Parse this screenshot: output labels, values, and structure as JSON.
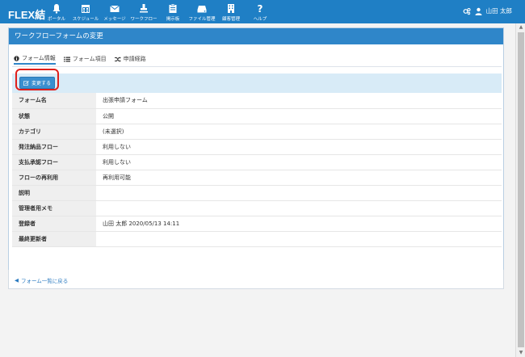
{
  "app": {
    "logo": "FLEX結"
  },
  "nav": [
    {
      "id": "portal",
      "label": "ポータル"
    },
    {
      "id": "schedule",
      "label": "スケジュール"
    },
    {
      "id": "message",
      "label": "メッセージ"
    },
    {
      "id": "workflow",
      "label": "ワークフロー"
    },
    {
      "id": "board",
      "label": "掲示板"
    },
    {
      "id": "files",
      "label": "ファイル管理"
    },
    {
      "id": "customers",
      "label": "顧客管理"
    },
    {
      "id": "help",
      "label": "ヘルプ"
    }
  ],
  "user": {
    "name": "山田 太郎"
  },
  "panel": {
    "title": "ワークフローフォームの変更"
  },
  "tabs": [
    {
      "label": "フォーム情報",
      "active": true
    },
    {
      "label": "フォーム項目",
      "active": false
    },
    {
      "label": "申請経路",
      "active": false
    }
  ],
  "actions": {
    "edit_label": "変更する"
  },
  "rows": [
    {
      "label": "フォーム名",
      "value": "出張申請フォーム"
    },
    {
      "label": "状態",
      "value": "公開"
    },
    {
      "label": "カテゴリ",
      "value": "(未選択)"
    },
    {
      "label": "発注納品フロー",
      "value": "利用しない"
    },
    {
      "label": "支払承認フロー",
      "value": "利用しない"
    },
    {
      "label": "フローの再利用",
      "value": "再利用可能"
    },
    {
      "label": "説明",
      "value": ""
    },
    {
      "label": "管理者用メモ",
      "value": ""
    },
    {
      "label": "登録者",
      "value": "山田 太郎 2020/05/13 14:11"
    },
    {
      "label": "最終更新者",
      "value": ""
    }
  ],
  "footer": {
    "back_label": "フォーム一覧に戻る"
  },
  "colors": {
    "header": "#1f7fc5",
    "panel_header": "#2f86c9",
    "button": "#3a8fcf",
    "highlight": "#e0201b"
  }
}
